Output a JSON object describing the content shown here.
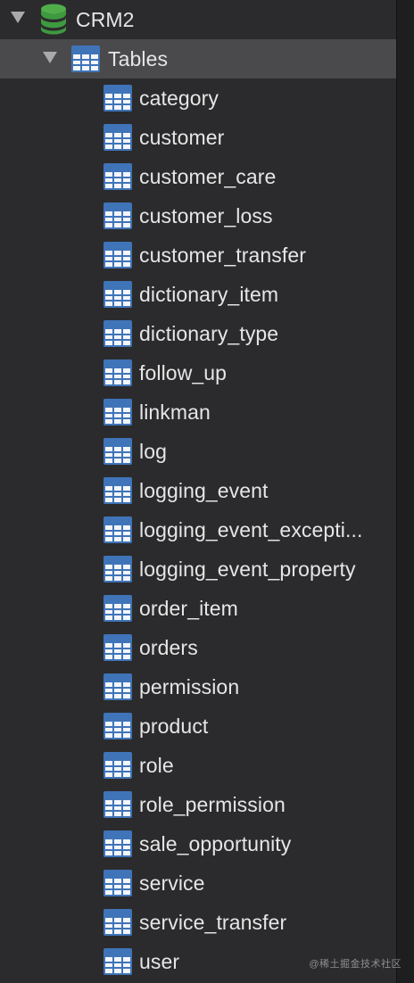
{
  "database": {
    "name": "CRM2",
    "icon": "database-icon"
  },
  "group": {
    "label": "Tables",
    "icon": "table-icon"
  },
  "tables": [
    {
      "label": "category"
    },
    {
      "label": "customer"
    },
    {
      "label": "customer_care"
    },
    {
      "label": "customer_loss"
    },
    {
      "label": "customer_transfer"
    },
    {
      "label": "dictionary_item"
    },
    {
      "label": "dictionary_type"
    },
    {
      "label": "follow_up"
    },
    {
      "label": "linkman"
    },
    {
      "label": "log"
    },
    {
      "label": "logging_event"
    },
    {
      "label": "logging_event_excepti..."
    },
    {
      "label": "logging_event_property"
    },
    {
      "label": "order_item"
    },
    {
      "label": "orders"
    },
    {
      "label": "permission"
    },
    {
      "label": "product"
    },
    {
      "label": "role"
    },
    {
      "label": "role_permission"
    },
    {
      "label": "sale_opportunity"
    },
    {
      "label": "service"
    },
    {
      "label": "service_transfer"
    },
    {
      "label": "user"
    }
  ],
  "watermark": "@稀土掘金技术社区",
  "colors": {
    "background": "#2b2b2d",
    "selected_row": "#4a4a4c",
    "table_icon": "#3f74b8",
    "db_icon": "#3e9a3f",
    "text": "#e6e6e6"
  }
}
